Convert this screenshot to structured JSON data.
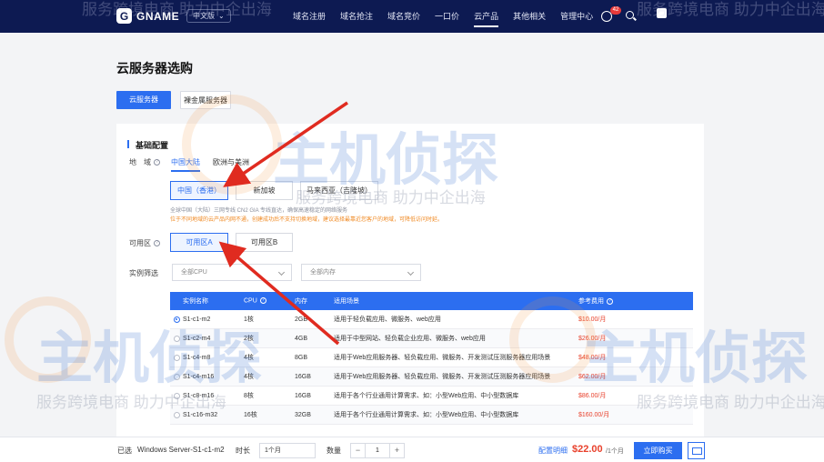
{
  "header": {
    "logo_text": "GNAME",
    "language": "中文版",
    "nav": [
      "域名注册",
      "域名抢注",
      "域名竞价",
      "一口价",
      "云产品",
      "其他相关",
      "管理中心"
    ],
    "active_nav": "云产品",
    "notification_count": "42"
  },
  "page": {
    "title": "云服务器选购",
    "mode_tabs": [
      "云服务器",
      "裸金属服务器"
    ]
  },
  "config": {
    "section_title": "基础配置",
    "region_label": "地　域",
    "region_tabs": [
      "中国大陆",
      "欧洲与美洲"
    ],
    "regions": [
      "中国（香港）",
      "新加坡",
      "马来西亚（吉隆坡）"
    ],
    "region_note": "全球中国（大陆）三网专线 CN2 GIA 专线直达，确保高速稳定的网络服务",
    "region_warning": "位于不同地域的云产品内网不通，创建成功后不支持切换地域，建议选择最靠近您客户的地域，可降低访问时延。",
    "zone_label": "可用区",
    "zones": [
      "可用区A",
      "可用区B"
    ],
    "filter_label": "实例筛选",
    "cpu_filter": "全部CPU",
    "mem_filter": "全部内存"
  },
  "table": {
    "headers": {
      "name": "实例名称",
      "cpu": "CPU",
      "mem": "内存",
      "use": "适用场景",
      "price": "参考费用"
    },
    "rows": [
      {
        "name": "S1-c1-m2",
        "cpu": "1核",
        "mem": "2GB",
        "use": "适用于轻负载应用、微服务、web应用",
        "price": "$10.00/月"
      },
      {
        "name": "S1-c2-m4",
        "cpu": "2核",
        "mem": "4GB",
        "use": "适用于中型网站、轻负载企业应用、微服务、web应用",
        "price": "$26.00/月"
      },
      {
        "name": "S1-c4-m8",
        "cpu": "4核",
        "mem": "8GB",
        "use": "适用于Web应用服务器、轻负载应用、微服务、开发测试压测服务器应用场景",
        "price": "$48.00/月"
      },
      {
        "name": "S1-c4-m16",
        "cpu": "4核",
        "mem": "16GB",
        "use": "适用于Web应用服务器、轻负载应用、微服务、开发测试压测服务器应用场景",
        "price": "$62.00/月"
      },
      {
        "name": "S1-c8-m16",
        "cpu": "8核",
        "mem": "16GB",
        "use": "适用于各个行业通用计算需求、如：小型Web应用、中小型数据库",
        "price": "$86.00/月"
      },
      {
        "name": "S1-c16-m32",
        "cpu": "16核",
        "mem": "32GB",
        "use": "适用于各个行业通用计算需求、如：小型Web应用、中小型数据库",
        "price": "$160.00/月"
      }
    ]
  },
  "footer": {
    "selected_label": "已选",
    "selected_value": "Windows Server-S1-c1-m2",
    "duration_label": "时长",
    "duration_value": "1个月",
    "qty_label": "数量",
    "qty_value": "1",
    "config_detail": "配置明细",
    "price": "$22.00",
    "price_unit": "/1个月",
    "buy_label": "立即购买"
  },
  "watermark": {
    "logo_text": "主机侦探",
    "slogan": "服务跨境电商 助力中企出海"
  },
  "colors": {
    "header_bg": "#0d1a52",
    "primary": "#2c6ef0",
    "price_red": "#e8412c",
    "annotation_red": "#e02b20"
  }
}
